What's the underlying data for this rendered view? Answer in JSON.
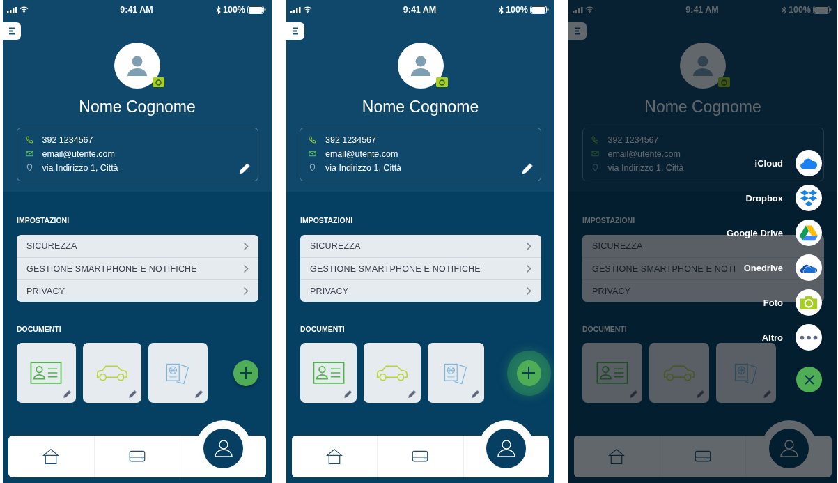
{
  "screens": [
    {
      "status_bar": {
        "time": "9:41 AM",
        "battery": "100%"
      },
      "profile": {
        "name": "Nome Cognome",
        "contacts": [
          {
            "kind": "phone",
            "text": "392 1234567"
          },
          {
            "kind": "email",
            "text": "email@utente.com"
          },
          {
            "kind": "address",
            "text": "via Indirizzo 1, Città"
          }
        ]
      },
      "settings": {
        "title": "IMPOSTAZIONI",
        "items": [
          "SICUREZZA",
          "GESTIONE SMARTPHONE E NOTIFICHE",
          "PRIVACY"
        ]
      },
      "documents": {
        "title": "DOCUMENTI",
        "items": [
          {
            "kind": "id-card"
          },
          {
            "kind": "car"
          },
          {
            "kind": "passport"
          }
        ],
        "add_button": {
          "pressed": false
        }
      },
      "tab_bar": [
        {
          "kind": "home",
          "selected": false
        },
        {
          "kind": "cards",
          "selected": false
        },
        {
          "kind": "profile",
          "selected": true
        }
      ]
    },
    {
      "status_bar": {
        "time": "9:41 AM",
        "battery": "100%"
      },
      "profile": {
        "name": "Nome Cognome",
        "contacts": [
          {
            "kind": "phone",
            "text": "392 1234567"
          },
          {
            "kind": "email",
            "text": "email@utente.com"
          },
          {
            "kind": "address",
            "text": "via Indirizzo 1, Città"
          }
        ]
      },
      "settings": {
        "title": "IMPOSTAZIONI",
        "items": [
          "SICUREZZA",
          "GESTIONE SMARTPHONE E NOTIFICHE",
          "PRIVACY"
        ]
      },
      "documents": {
        "title": "DOCUMENTI",
        "items": [
          {
            "kind": "id-card"
          },
          {
            "kind": "car"
          },
          {
            "kind": "passport"
          }
        ],
        "add_button": {
          "pressed": true
        }
      },
      "tab_bar": [
        {
          "kind": "home",
          "selected": false
        },
        {
          "kind": "cards",
          "selected": false
        },
        {
          "kind": "profile",
          "selected": true
        }
      ]
    },
    {
      "status_bar": {
        "time": "9:41 AM",
        "battery": "100%"
      },
      "profile": {
        "name": "Nome Cognome",
        "contacts": [
          {
            "kind": "phone",
            "text": "392 1234567"
          },
          {
            "kind": "email",
            "text": "email@utente.com"
          },
          {
            "kind": "address",
            "text": "via Indirizzo 1, Città"
          }
        ]
      },
      "settings": {
        "title": "IMPOSTAZIONI",
        "items": [
          "SICUREZZA",
          "GESTIONE SMARTPHONE E NOTI",
          "PRIVACY"
        ]
      },
      "documents": {
        "title": "DOCUMENTI",
        "items": [
          {
            "kind": "id-card"
          },
          {
            "kind": "car"
          },
          {
            "kind": "passport"
          }
        ]
      },
      "tab_bar": [
        {
          "kind": "home",
          "selected": false
        },
        {
          "kind": "cards",
          "selected": false
        },
        {
          "kind": "profile",
          "selected": true
        }
      ],
      "share_menu": {
        "items": [
          {
            "kind": "icloud",
            "label": "iCloud"
          },
          {
            "kind": "dropbox",
            "label": "Dropbox"
          },
          {
            "kind": "gdrive",
            "label": "Google Drive"
          },
          {
            "kind": "onedrive",
            "label": "Onedrive"
          },
          {
            "kind": "photo",
            "label": "Foto"
          },
          {
            "kind": "more",
            "label": "Altro"
          }
        ]
      }
    }
  ]
}
